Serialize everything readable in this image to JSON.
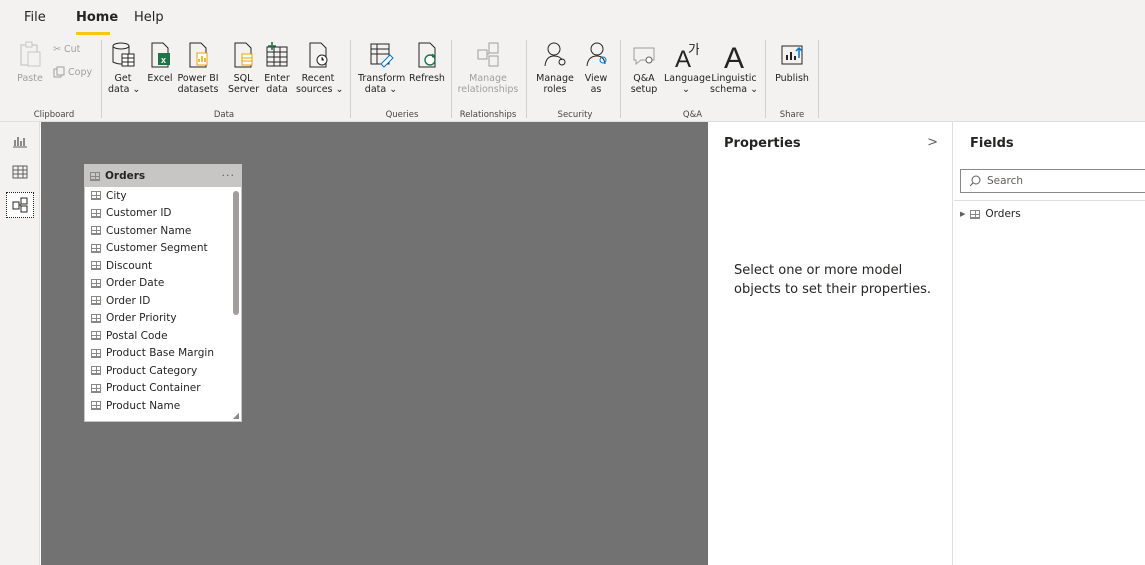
{
  "menu": {
    "tabs": [
      "File",
      "Home",
      "Help"
    ]
  },
  "ribbon": {
    "clipboard": {
      "paste": "Paste",
      "cut": "Cut",
      "copy": "Copy",
      "group": "Clipboard"
    },
    "data": {
      "get_data": "Get\ndata ⌄",
      "excel": "Excel",
      "power_bi": "Power BI\ndatasets",
      "sql": "SQL\nServer",
      "enter_data": "Enter\ndata",
      "recent": "Recent\nsources ⌄",
      "group": "Data"
    },
    "queries": {
      "transform": "Transform\ndata ⌄",
      "refresh": "Refresh",
      "group": "Queries"
    },
    "relationships": {
      "manage": "Manage\nrelationships",
      "group": "Relationships"
    },
    "security": {
      "manage_roles": "Manage\nroles",
      "view_as": "View\nas",
      "group": "Security"
    },
    "qa": {
      "setup": "Q&A\nsetup",
      "language": "Language\n⌄",
      "linguistic": "Linguistic\nschema ⌄",
      "group": "Q&A"
    },
    "share": {
      "publish": "Publish",
      "group": "Share"
    }
  },
  "canvas": {
    "table": {
      "name": "Orders",
      "more": "···",
      "fields": [
        "City",
        "Customer ID",
        "Customer Name",
        "Customer Segment",
        "Discount",
        "Order Date",
        "Order ID",
        "Order Priority",
        "Postal Code",
        "Product Base Margin",
        "Product Category",
        "Product Container",
        "Product Name"
      ]
    }
  },
  "properties": {
    "title": "Properties",
    "chevron": ">",
    "message": "Select one or more model objects to set their properties."
  },
  "fields_pane": {
    "title": "Fields",
    "search_placeholder": "Search",
    "tables": [
      "Orders"
    ]
  },
  "colors": {
    "accent": "#f2c811",
    "canvas": "#727272",
    "ribbon_bg": "#f3f2f1"
  }
}
